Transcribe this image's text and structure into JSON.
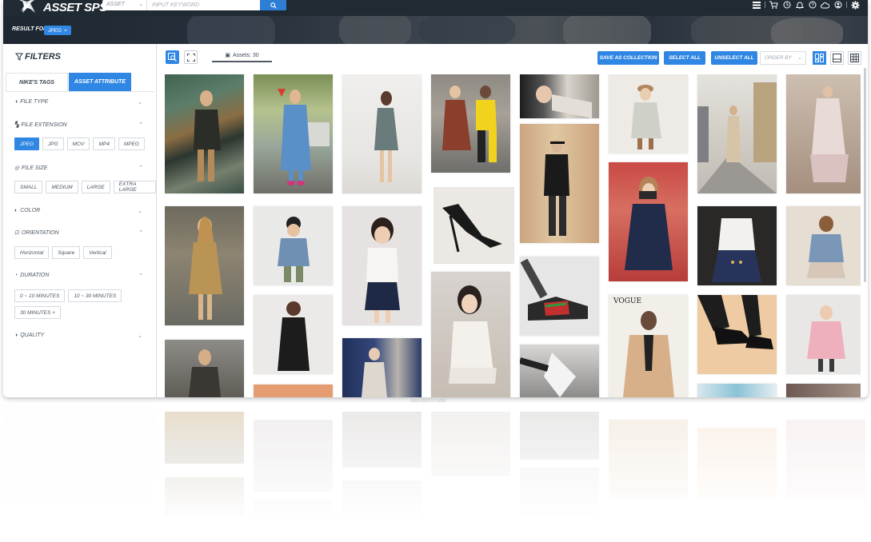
{
  "app": {
    "brand": "ASSET SPS"
  },
  "search": {
    "scope": "ASSET",
    "placeholder": "INPUT KEYWORD"
  },
  "result": {
    "label": "RESULT FOR",
    "chip": "JPEG"
  },
  "filters": {
    "title": "FILTERS",
    "tabs": [
      "NIKE'S TAGS",
      "ASSET ATTRIBUTE"
    ],
    "sections": {
      "file_type": "FILE TYPE",
      "file_extension": "FILE EXTENSION",
      "file_size": "FILE SIZE",
      "color": "COLOR",
      "orientation": "ORIENTATION",
      "duration": "DURATION",
      "quality": "QUALITY"
    },
    "extensions": [
      "JPEG",
      "JPG",
      "MOV",
      "MP4",
      "MPEG"
    ],
    "sizes": [
      "SMALL",
      "MEDIUM",
      "LARGE",
      "EXTRA LARGE"
    ],
    "orientations": [
      "Horizontal",
      "Square",
      "Vertical"
    ],
    "durations": [
      "0 ~ 10 MINUTES",
      "10 ~ 30 MINUTES",
      "30 MINUTES +"
    ]
  },
  "toolbar": {
    "asset_count": "Assets: 30",
    "save_as_collection": "SAVE AS COLLECTION",
    "select_all": "SELECT ALL",
    "unselect_all": "UNSELECT ALL",
    "order_by": "ORDER BY"
  },
  "gallery": {
    "vogue_text": "VOGUE"
  },
  "footer": {
    "copyright": "2022-2023 © CVDK"
  },
  "colors": {
    "accent": "#2f86e3",
    "topbar": "#1f2a33"
  },
  "icons": [
    "search-icon",
    "list-icon",
    "cart-icon",
    "history-icon",
    "bell-icon",
    "help-icon",
    "cloud-icon",
    "user-icon",
    "gear-icon",
    "filter-icon",
    "fullscreen-icon",
    "image-search-icon"
  ]
}
